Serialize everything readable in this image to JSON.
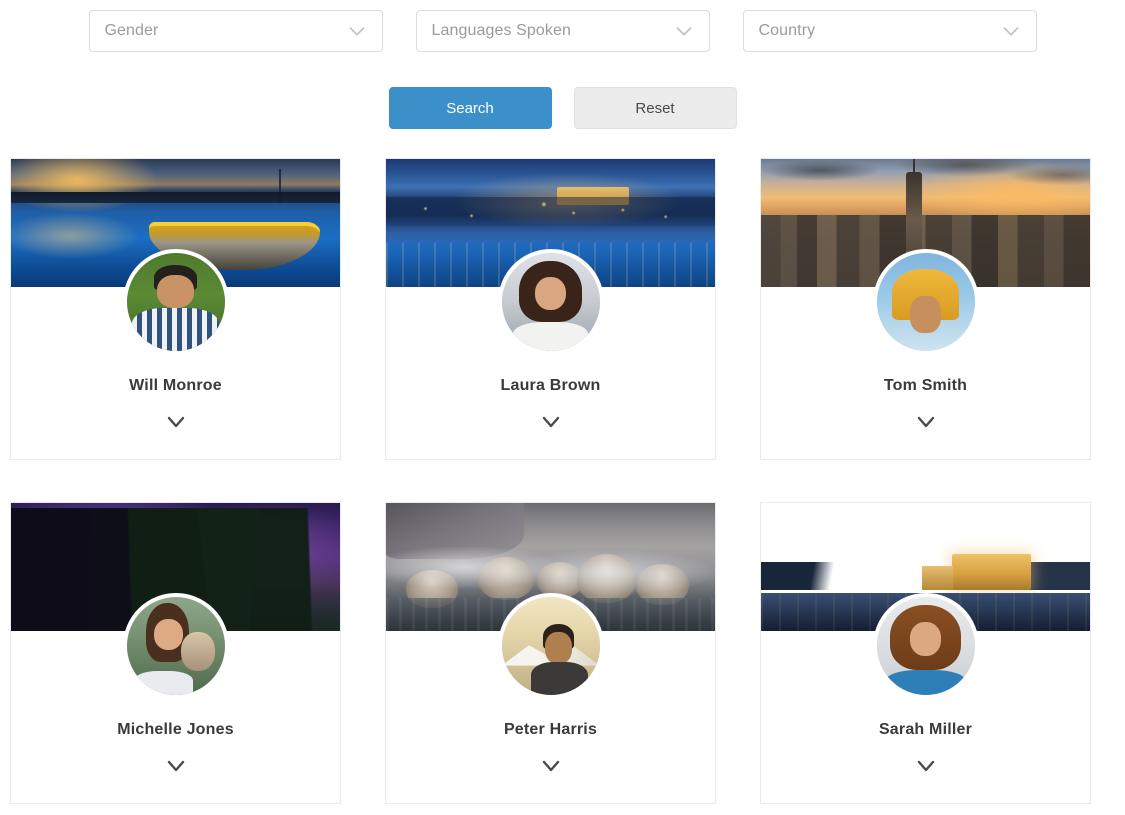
{
  "filters": [
    {
      "name": "gender",
      "label": "Gender",
      "value": "",
      "placeholder": "Gender",
      "icon": "chevron-down-icon"
    },
    {
      "name": "languages",
      "label": "Languages Spoken",
      "value": "",
      "placeholder": "Languages Spoken",
      "icon": "chevron-down-icon"
    },
    {
      "name": "country",
      "label": "Country",
      "value": "",
      "placeholder": "Country",
      "icon": "chevron-down-icon"
    }
  ],
  "actions": {
    "search_label": "Search",
    "reset_label": "Reset",
    "primary_color": "#3c90ca",
    "secondary_color": "#ececec"
  },
  "cards": [
    {
      "name": "Will Monroe",
      "cover": "boat-at-sunset",
      "avatar": "man-in-checked-shirt",
      "expand_icon": "chevron-down-icon"
    },
    {
      "name": "Laura Brown",
      "cover": "city-at-night",
      "avatar": "woman-curly-hair",
      "expand_icon": "chevron-down-icon"
    },
    {
      "name": "Tom Smith",
      "cover": "new-york-skyline",
      "avatar": "man-with-towel",
      "expand_icon": "chevron-down-icon"
    },
    {
      "name": "Michelle Jones",
      "cover": "aurora-night-forest",
      "avatar": "woman-with-dog",
      "expand_icon": "chevron-down-icon"
    },
    {
      "name": "Peter Harris",
      "cover": "snow-monkeys-hotspring",
      "avatar": "man-drinking-outdoors",
      "expand_icon": "chevron-down-icon"
    },
    {
      "name": "Sarah Miller",
      "cover": "castle-by-the-loch",
      "avatar": "woman-smiling-blue-top",
      "expand_icon": "chevron-down-icon"
    }
  ]
}
